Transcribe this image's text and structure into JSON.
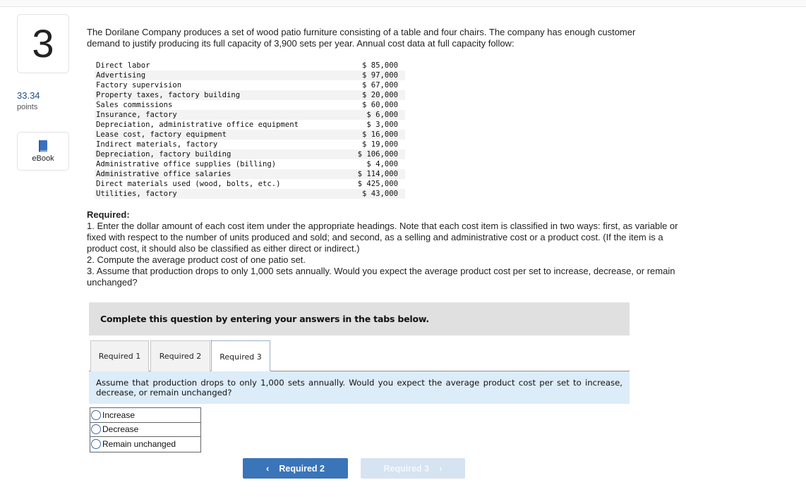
{
  "question": {
    "number": "3",
    "points_value": "33.34",
    "points_label": "points",
    "ebook_label": "eBook",
    "ebook_icon": "book-icon"
  },
  "intro": "The Dorilane Company produces a set of wood patio furniture consisting of a table and four chairs. The company has enough customer demand to justify producing its full capacity of 3,900 sets per year. Annual cost data at full capacity follow:",
  "cost_items": [
    {
      "label": "Direct labor",
      "amount": "$ 85,000"
    },
    {
      "label": "Advertising",
      "amount": "$ 97,000"
    },
    {
      "label": "Factory supervision",
      "amount": "$ 67,000"
    },
    {
      "label": "Property taxes, factory building",
      "amount": "$ 20,000"
    },
    {
      "label": "Sales commissions",
      "amount": "$ 60,000"
    },
    {
      "label": "Insurance, factory",
      "amount": "$ 6,000"
    },
    {
      "label": "Depreciation, administrative office equipment",
      "amount": "$ 3,000"
    },
    {
      "label": "Lease cost, factory equipment",
      "amount": "$ 16,000"
    },
    {
      "label": "Indirect materials, factory",
      "amount": "$ 19,000"
    },
    {
      "label": "Depreciation, factory building",
      "amount": "$ 106,000"
    },
    {
      "label": "Administrative office supplies (billing)",
      "amount": "$ 4,000"
    },
    {
      "label": "Administrative office salaries",
      "amount": "$ 114,000"
    },
    {
      "label": "Direct materials used (wood, bolts, etc.)",
      "amount": "$ 425,000"
    },
    {
      "label": "Utilities, factory",
      "amount": "$ 43,000"
    }
  ],
  "required": {
    "title": "Required:",
    "items": [
      "1. Enter the dollar amount of each cost item under the appropriate headings. Note that each cost item is classified in two ways: first, as variable or fixed with respect to the number of units produced and sold; and second, as a selling and administrative cost or a product cost. (If the item is a product cost, it should also be classified as either direct or indirect.)",
      "2. Compute the average product cost of one patio set.",
      "3. Assume that production drops to only 1,000 sets annually. Would you expect the average product cost per set to increase, decrease, or remain unchanged?"
    ]
  },
  "complete_prompt": "Complete this question by entering your answers in the tabs below.",
  "tabs": [
    {
      "label": "Required 1",
      "active": false
    },
    {
      "label": "Required 2",
      "active": false
    },
    {
      "label": "Required 3",
      "active": true
    }
  ],
  "tab_content": {
    "question": "Assume that production drops to only 1,000 sets annually. Would you expect the average product cost per set to increase, decrease, or remain unchanged?",
    "options": [
      "Increase",
      "Decrease",
      "Remain unchanged"
    ],
    "selected": null
  },
  "navigation": {
    "prev_label": "Required 2",
    "prev_icon": "chevron-left-icon",
    "next_label": "Required 3",
    "next_icon": "chevron-right-icon",
    "next_disabled": true
  },
  "colors": {
    "primary_button": "#3a75b9",
    "disabled_button": "#d6e3f1",
    "tab_content_bg": "#dcecf8",
    "prompt_bg": "#e0e0e0",
    "points_text": "#1a4f8a"
  }
}
